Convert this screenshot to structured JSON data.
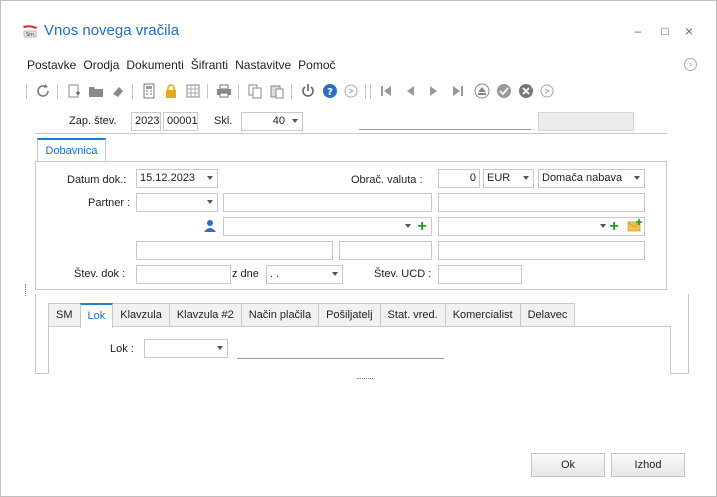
{
  "window": {
    "title": "Vnos novega vračila",
    "controls": {
      "minimize": "–",
      "maximize": "□",
      "close": "×"
    }
  },
  "menu": {
    "items": [
      "Postavke",
      "Orodja",
      "Dokumenti",
      "Šifranti",
      "Nastavitve",
      "Pomoč"
    ]
  },
  "toolbar": {
    "icons": [
      "refresh-icon",
      "new-doc-icon",
      "folder-icon",
      "eraser-icon",
      "calculator-icon",
      "lock-icon",
      "grid-icon",
      "print-icon",
      "copy-icon",
      "paste-icon",
      "power-icon",
      "help-icon",
      "nav-icon",
      "first-icon",
      "prev-icon",
      "next-icon",
      "last-icon",
      "eject-icon",
      "confirm-icon",
      "cancel-icon",
      "more-icon"
    ]
  },
  "header": {
    "zap_stev_label": "Zap. štev.",
    "year_value": "2023",
    "number_value": "00001",
    "skl_label": "Skl.",
    "skl_value": "40"
  },
  "main_tab": {
    "label": "Dobavnica"
  },
  "form": {
    "datum_dok_label": "Datum dok.:",
    "datum_dok_value": "15.12.2023",
    "obrac_valuta_label": "Obrač. valuta :",
    "obrac_valuta_rate": "0",
    "currency_value": "EUR",
    "nabava_value": "Domača nabava",
    "partner_label": "Partner :",
    "stev_dok_label": "Štev. dok :",
    "z_dne_label": "z dne",
    "z_dne_value": ". .",
    "stev_ucd_label": "Štev. UCD :"
  },
  "sub_tabs": [
    "SM",
    "Lok",
    "Klavzula",
    "Klavzula #2",
    "Način plačila",
    "Pošiljatelj",
    "Stat. vred.",
    "Komercialist",
    "Delavec"
  ],
  "sub_panel": {
    "lok_label": "Lok :"
  },
  "buttons": {
    "ok": "Ok",
    "izhod": "Izhod"
  },
  "colors": {
    "accent": "#1e6fc6",
    "tab_accent": "#1e7fd6",
    "plus_green": "#19a019"
  }
}
